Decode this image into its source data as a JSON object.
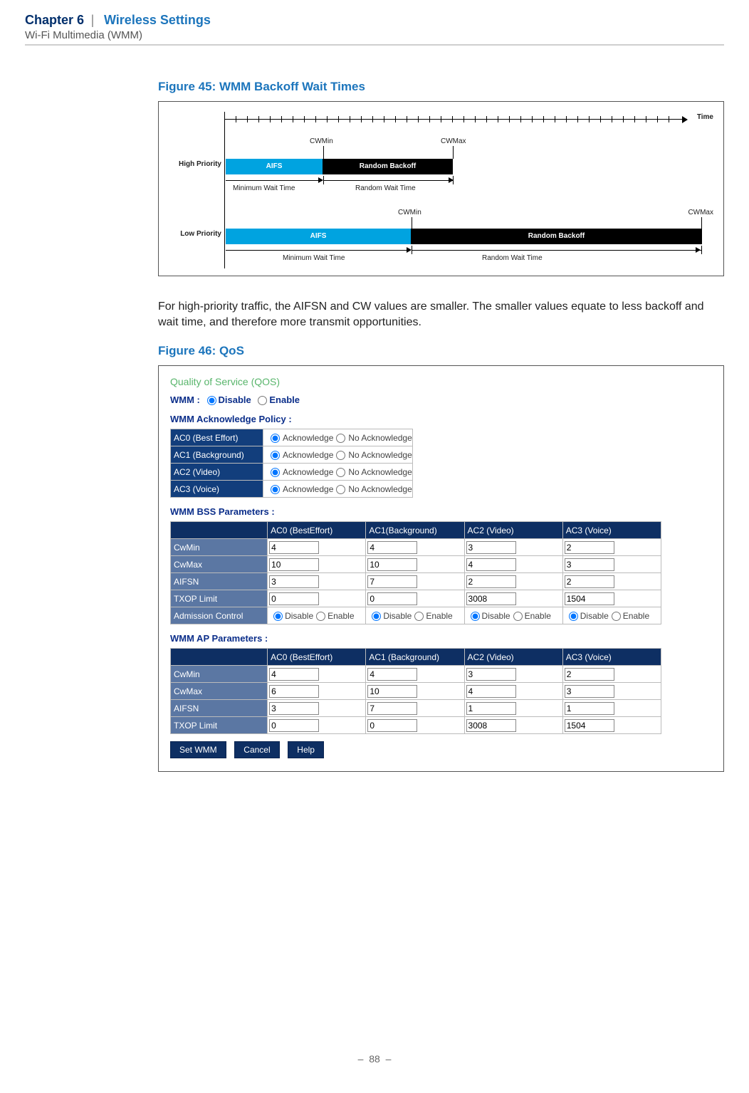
{
  "header": {
    "chapter_num": "Chapter 6",
    "divider": "|",
    "chapter_title": "Wireless Settings",
    "subtitle": "Wi-Fi Multimedia (WMM)"
  },
  "figure45": {
    "title": "Figure 45:  WMM Backoff Wait Times",
    "time_label": "Time",
    "high_priority": "High Priority",
    "low_priority": "Low Priority",
    "cwmin": "CWMin",
    "cwmax": "CWMax",
    "aifs": "AIFS",
    "random_backoff": "Random Backoff",
    "min_wait": "Minimum Wait Time",
    "rand_wait": "Random Wait Time"
  },
  "paragraph": "For high-priority traffic, the AIFSN and CW values are smaller. The smaller values equate to less backoff and wait time, and therefore more transmit opportunities.",
  "figure46": {
    "title": "Figure 46:  QoS",
    "qos_heading": "Quality of Service (QOS)",
    "wmm_label": "WMM :",
    "disable": "Disable",
    "enable": "Enable",
    "ack_title": "WMM Acknowledge Policy :",
    "ack_rows": [
      {
        "label": "AC0 (Best Effort)",
        "ack": "Acknowledge",
        "nack": "No Acknowledge"
      },
      {
        "label": "AC1 (Background)",
        "ack": "Acknowledge",
        "nack": "No Acknowledge"
      },
      {
        "label": "AC2 (Video)",
        "ack": "Acknowledge",
        "nack": "No Acknowledge"
      },
      {
        "label": "AC3 (Voice)",
        "ack": "Acknowledge",
        "nack": "No Acknowledge"
      }
    ],
    "bss_title": "WMM BSS Parameters :",
    "col_headers": [
      "",
      "AC0 (BestEffort)",
      "AC1(Background)",
      "AC2 (Video)",
      "AC3 (Voice)"
    ],
    "bss": {
      "CwMin": [
        "4",
        "4",
        "3",
        "2"
      ],
      "CwMax": [
        "10",
        "10",
        "4",
        "3"
      ],
      "AIFSN": [
        "3",
        "7",
        "2",
        "2"
      ],
      "TXOP Limit": [
        "0",
        "0",
        "3008",
        "1504"
      ],
      "adm_row": "Admission Control",
      "adm_opts": {
        "d": "Disable",
        "e": "Enable"
      }
    },
    "ap_title": "WMM AP Parameters :",
    "ap_col_headers": [
      "",
      "AC0 (BestEffort)",
      "AC1 (Background)",
      "AC2 (Video)",
      "AC3 (Voice)"
    ],
    "ap": {
      "CwMin": [
        "4",
        "4",
        "3",
        "2"
      ],
      "CwMax": [
        "6",
        "10",
        "4",
        "3"
      ],
      "AIFSN": [
        "3",
        "7",
        "1",
        "1"
      ],
      "TXOP Limit": [
        "0",
        "0",
        "3008",
        "1504"
      ]
    },
    "buttons": {
      "set": "Set WMM",
      "cancel": "Cancel",
      "help": "Help"
    }
  },
  "footer": {
    "dash": "–",
    "page": "88"
  }
}
